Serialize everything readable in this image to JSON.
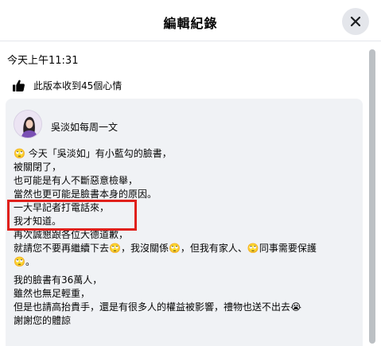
{
  "dialog": {
    "title": "編輯紀錄",
    "close_icon": "close-icon"
  },
  "edit": {
    "timestamp": "今天上午11:31",
    "reactions_icon": "thumbs-up-icon",
    "reactions_text": "此版本收到45個心情"
  },
  "post": {
    "author": "吳淡如每周一文",
    "lines": [
      "🙄 今天「吳淡如」有小藍勾的臉書，",
      "被關閉了，",
      "也可能是有人不斷惡意檢舉，",
      "當然也更可能是臉書本身的原因。",
      "一大早記者打電話來，",
      "我才知道。",
      "再次誠懇跟各位大德道歉，",
      "就請您不要再繼續下去🙄，我沒關係🙄，但我有家人、🙄同事需要保護",
      "🙄。",
      "我的臉書有36萬人，",
      "雖然也無足輕重，",
      "但是也請高抬貴手，還是有很多人的權益被影響，禮物也送不出去😭",
      "謝謝您的體諒"
    ]
  },
  "colors": {
    "highlight_border": "#e0201b",
    "card_background": "#f0f2f5",
    "scrollbar": "#bcc0c4"
  }
}
